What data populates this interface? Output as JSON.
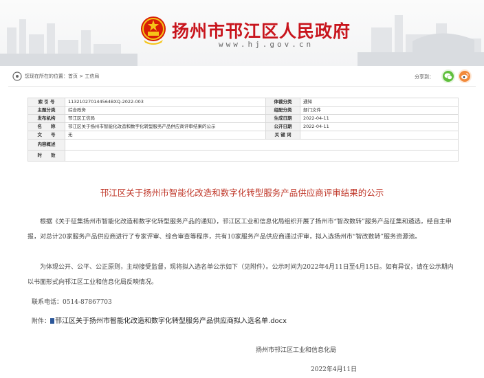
{
  "banner": {
    "title": "扬州市邗江区人民政府",
    "url": "www.hj.gov.cn"
  },
  "breadcrumb": {
    "prefix": "您现在所在的位置：",
    "home": "首页",
    "separator": " > ",
    "current": "工信局"
  },
  "share": {
    "label": "分享到："
  },
  "meta": {
    "rows": [
      {
        "l1": "索 引 号",
        "v1": "113210270144564BXQ-2022-003",
        "l2": "体裁分类",
        "v2": "通知"
      },
      {
        "l1": "主题分类",
        "v1": "综合政务",
        "l2": "组配分类",
        "v2": "部门文件"
      },
      {
        "l1": "发布机构",
        "v1": "邗江区工信局",
        "l2": "生成日期",
        "v2": "2022-04-11"
      },
      {
        "l1": "名　　称",
        "v1": "邗江区关于扬州市智能化改造和数字化转型服务产品供应商评审结果的公示",
        "l2": "公开日期",
        "v2": "2022-04-11"
      },
      {
        "l1": "文　　号",
        "v1": "无",
        "l2": "关 键 词",
        "v2": ""
      }
    ],
    "summary_label": "内容概述",
    "summary_value": "",
    "timeliness_label": "时　　效",
    "timeliness_value": ""
  },
  "article": {
    "title": "邗江区关于扬州市智能化改造和数字化转型服务产品供应商评审结果的公示",
    "para1": "根据《关于征集扬州市智能化改造和数字化转型服务产品的通知》，邗江区工业和信息化局组织开展了扬州市“智改数转”服务产品征集和遴选，经自主申报，对总计20家服务产品供应商进行了专家评审、综合审查等程序，共有10家服务产品供应商通过评审，拟入选扬州市“智改数转”服务资源池。",
    "para2": "为体现公开、公平、公正原则，主动接受监督，现将拟入选名单公示如下（见附件）。公示时间为2022年4月11日至4月15日。如有异议，请在公示期内以书面形式向邗江区工业和信息化局反映情况。",
    "contact": "联系电话：0514-87867703",
    "attach_label": "附件：",
    "attach_name": "邗江区关于扬州市智能化改造和数字化转型服务产品供应商拟入选名单.docx",
    "sign_org": "扬州市邗江区工业和信息化局",
    "sign_date": "2022年4月11日"
  }
}
